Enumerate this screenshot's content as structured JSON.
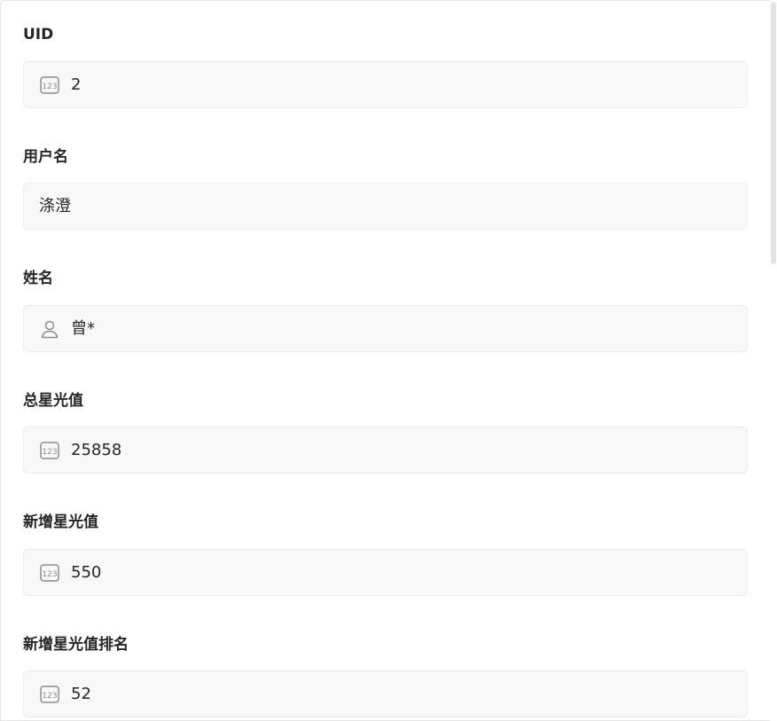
{
  "fields": [
    {
      "label": "UID",
      "value": "2",
      "icon": "number-icon"
    },
    {
      "label": "用户名",
      "value": "涤澄",
      "icon": null
    },
    {
      "label": "姓名",
      "value": "曾*",
      "icon": "user-icon"
    },
    {
      "label": "总星光值",
      "value": "25858",
      "icon": "number-icon"
    },
    {
      "label": "新增星光值",
      "value": "550",
      "icon": "number-icon"
    },
    {
      "label": "新增星光值排名",
      "value": "52",
      "icon": "number-icon"
    }
  ]
}
